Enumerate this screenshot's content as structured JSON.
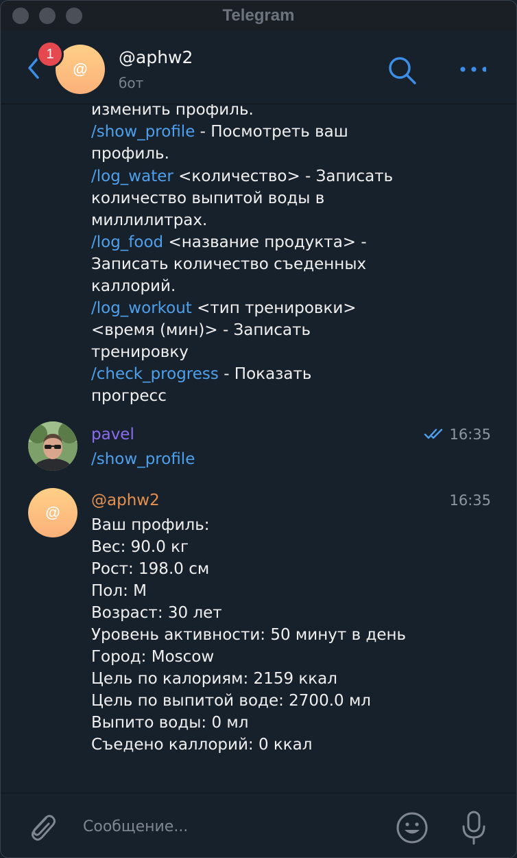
{
  "window": {
    "title": "Telegram"
  },
  "header": {
    "unread_count": "1",
    "avatar_letter": "@",
    "title": "@aphw2",
    "subtitle": "бот"
  },
  "messages": {
    "help_lines": [
      {
        "command": "",
        "text": "изменить профиль."
      },
      {
        "command": "/show_profile",
        "text": " - Посмотреть ваш"
      },
      {
        "command": "",
        "text": "профиль."
      },
      {
        "command": "/log_water",
        "text": " <количество> - Записать"
      },
      {
        "command": "",
        "text": "количество выпитой воды в"
      },
      {
        "command": "",
        "text": "миллилитрах."
      },
      {
        "command": "/log_food",
        "text": " <название продукта> -"
      },
      {
        "command": "",
        "text": "Записать количество съеденных"
      },
      {
        "command": "",
        "text": "каллорий."
      },
      {
        "command": "/log_workout",
        "text": " <тип тренировки>"
      },
      {
        "command": "",
        "text": "<время (мин)> - Записать"
      },
      {
        "command": "",
        "text": "тренировку"
      },
      {
        "command": "/check_progress",
        "text": " - Показать"
      },
      {
        "command": "",
        "text": "прогресс"
      }
    ],
    "user_message": {
      "sender": "pavel",
      "time": "16:35",
      "text": "/show_profile"
    },
    "bot_message": {
      "sender": "@aphw2",
      "avatar_letter": "@",
      "time": "16:35",
      "lines": [
        "Ваш профиль:",
        "Вес: 90.0 кг",
        "Рост: 198.0 см",
        "Пол: М",
        "Возраст: 30 лет",
        "Уровень активности: 50 минут в день",
        "Город: Moscow",
        "Цель по калориям: 2159 ккал",
        "Цель по выпитой воде: 2700.0 мл",
        "Выпито воды: 0 мл",
        "Съедено каллорий: 0 ккал"
      ]
    }
  },
  "composer": {
    "placeholder": "Сообщение..."
  },
  "colors": {
    "background": "#17212b",
    "command_link": "#4ea0ec",
    "sender_user": "#8a6df0",
    "sender_bot": "#e6904f",
    "badge": "#e5494f",
    "accent": "#3d8ee6"
  }
}
